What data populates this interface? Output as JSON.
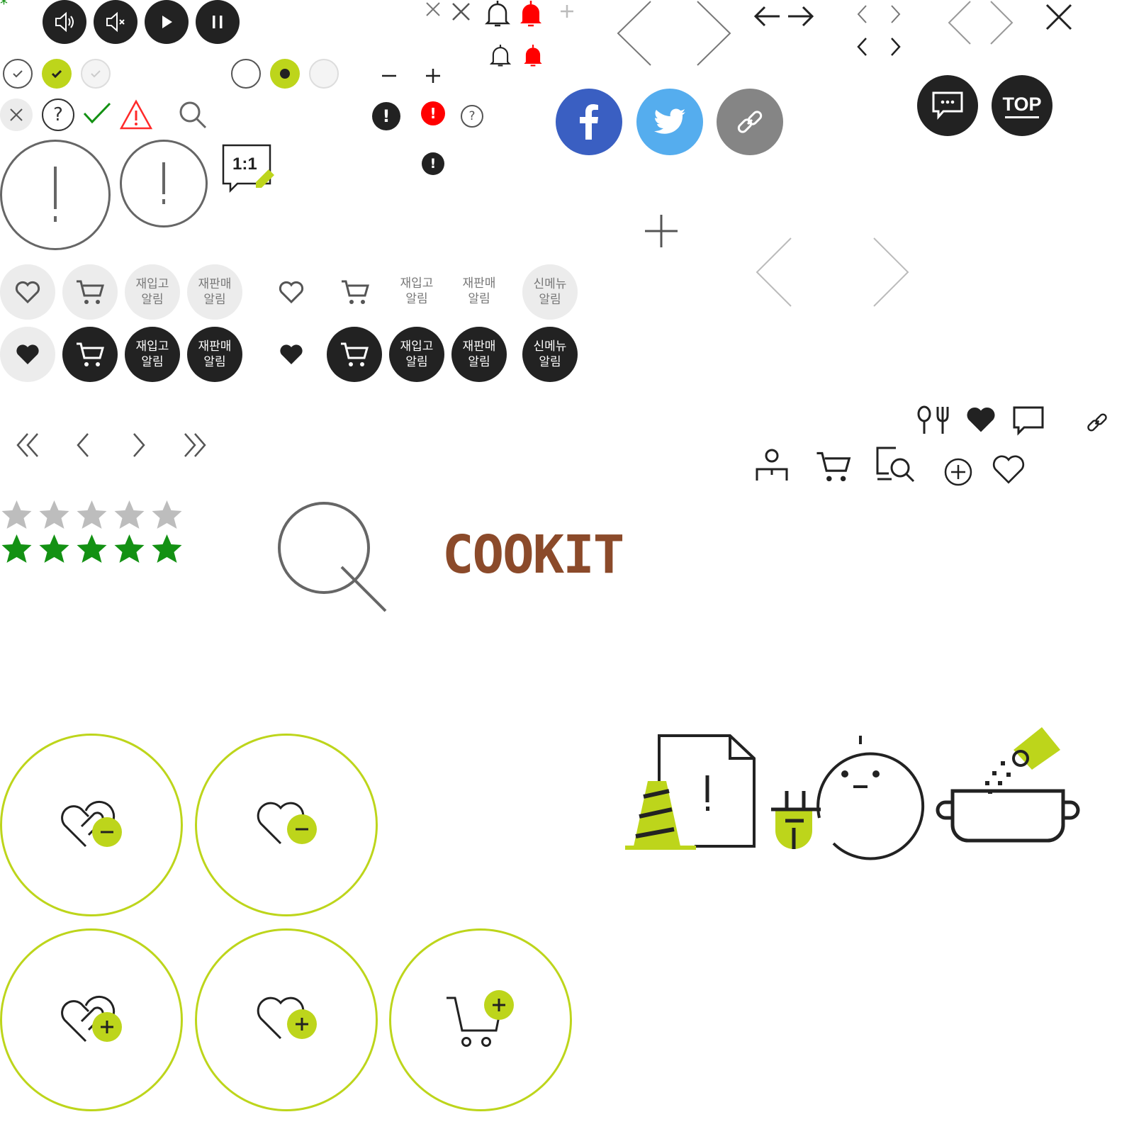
{
  "colors": {
    "dark": "#222222",
    "lime": "#bdd51b",
    "gray": "#777777",
    "light_gray": "#ececec",
    "red": "#ff0000",
    "green": "#139113",
    "facebook": "#3a5fc2",
    "twitter": "#55adee",
    "link_gray": "#858585",
    "brand_brown": "#8b4a2a"
  },
  "media_controls": [
    "volume-icon",
    "mute-icon",
    "play-icon",
    "pause-icon"
  ],
  "consult": {
    "ratio_label": "1:1"
  },
  "alert_buttons": {
    "restock": "재입고\n알림",
    "resale": "재판매\n알림",
    "new_menu": "신메뉴\n알림"
  },
  "social": [
    "facebook-icon",
    "twitter-icon",
    "link-icon"
  ],
  "top_button": {
    "label": "TOP"
  },
  "rating": {
    "max": 5,
    "gray_stars": 5,
    "green_stars": 5
  },
  "brand": {
    "logo": "COOKIT"
  },
  "large_circle_buttons": [
    "wish-remove-button",
    "heart-remove-button",
    "wish-add-button",
    "heart-add-button",
    "cart-add-button"
  ],
  "illustrations": [
    "error-page-illustration",
    "disconnected-illustration",
    "cooking-pot-illustration"
  ]
}
